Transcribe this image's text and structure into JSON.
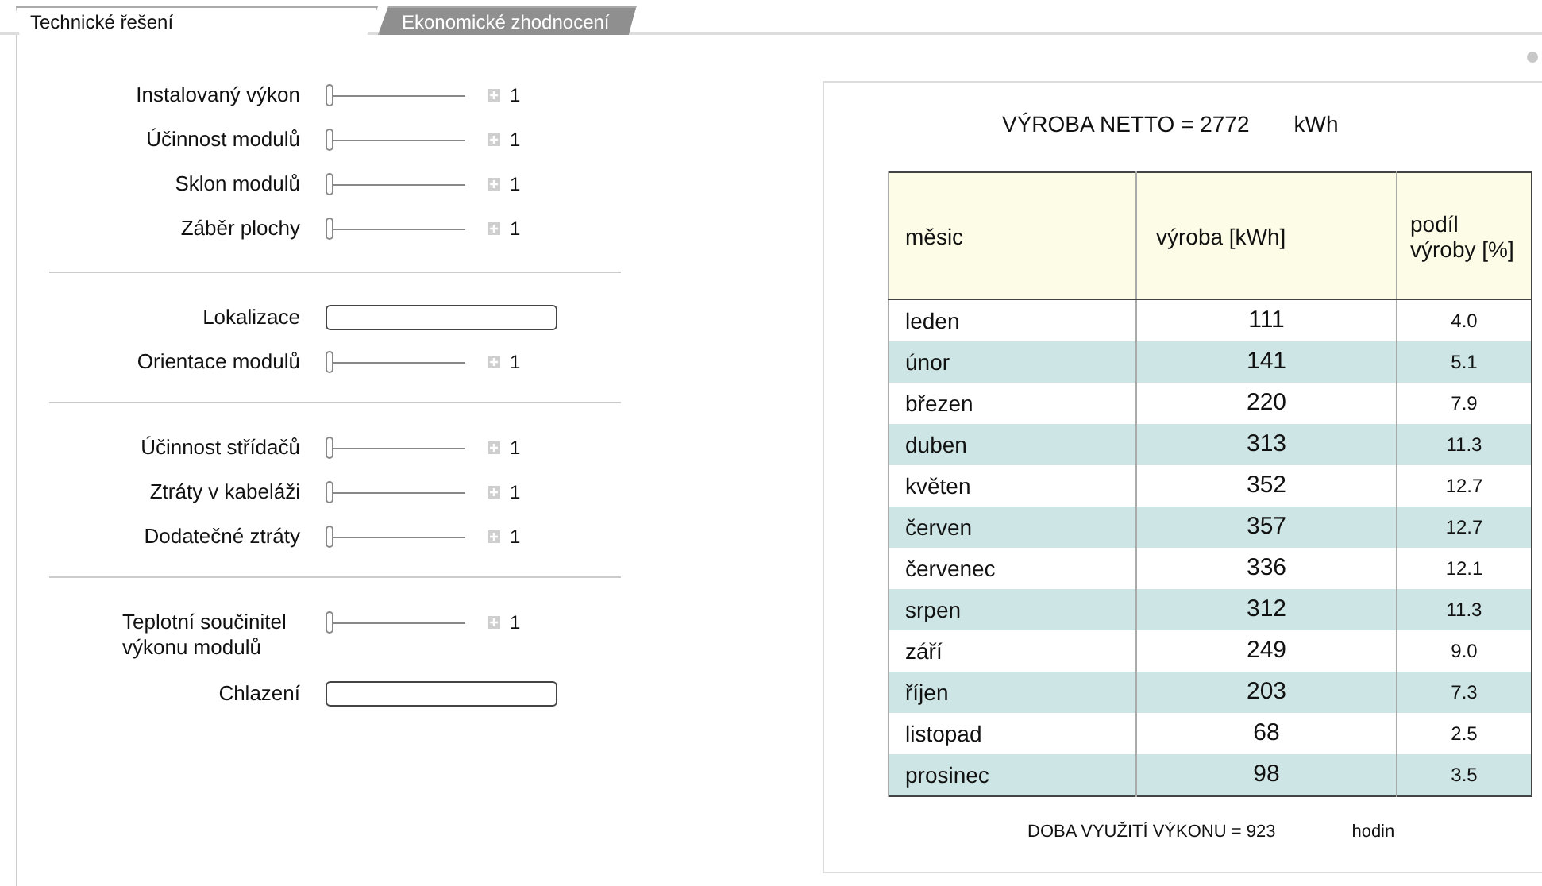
{
  "tabs": [
    {
      "label": "Technické řešení",
      "selected": true
    },
    {
      "label": "Ekonomické zhodnocení",
      "selected": false
    }
  ],
  "settings": {
    "groups": [
      [
        {
          "kind": "slider",
          "label": "Instalovaný výkon",
          "level": 0,
          "value": "1"
        },
        {
          "kind": "slider",
          "label": "Účinnost modulů",
          "level": 0,
          "value": "1"
        },
        {
          "kind": "slider",
          "label": "Sklon modulů",
          "level": 0,
          "value": "1"
        },
        {
          "kind": "slider",
          "label": "Záběr plochy",
          "level": 0,
          "value": "1"
        }
      ],
      [
        {
          "kind": "field",
          "label": "Lokalizace"
        },
        {
          "kind": "slider",
          "label": "Orientace modulů",
          "level": 0,
          "value": "1"
        }
      ],
      [
        {
          "kind": "slider",
          "label": "Účinnost střídačů",
          "level": 0,
          "value": "1"
        },
        {
          "kind": "slider",
          "label": "Ztráty v kabeláži",
          "level": 0,
          "value": "1"
        },
        {
          "kind": "slider",
          "label": "Dodatečné ztráty",
          "level": 0,
          "value": "1"
        }
      ],
      [
        {
          "kind": "slider",
          "label": "Teplotní součinitel výkonu modulů",
          "level": 0,
          "value": "1"
        },
        {
          "kind": "field",
          "label": "Chlazení"
        }
      ]
    ]
  },
  "results": {
    "total_label": "VÝROBA NETTO = 2772",
    "total_unit": "kWh",
    "table": {
      "columns": [
        "měsic",
        "výroba [kWh]",
        "podíl výroby [%]"
      ],
      "rows": [
        [
          "leden",
          "111",
          "4.0"
        ],
        [
          "únor",
          "141",
          "5.1"
        ],
        [
          "březen",
          "220",
          "7.9"
        ],
        [
          "duben",
          "313",
          "11.3"
        ],
        [
          "květen",
          "352",
          "12.7"
        ],
        [
          "červen",
          "357",
          "12.7"
        ],
        [
          "červenec",
          "336",
          "12.1"
        ],
        [
          "srpen",
          "312",
          "11.3"
        ],
        [
          "září",
          "249",
          "9.0"
        ],
        [
          "říjen",
          "203",
          "7.3"
        ],
        [
          "listopad",
          "68",
          "2.5"
        ],
        [
          "prosinec",
          "98",
          "3.5"
        ]
      ]
    },
    "usage_label": "DOBA VYUŽITÍ VÝKONU = 923",
    "usage_unit": "hodin"
  }
}
